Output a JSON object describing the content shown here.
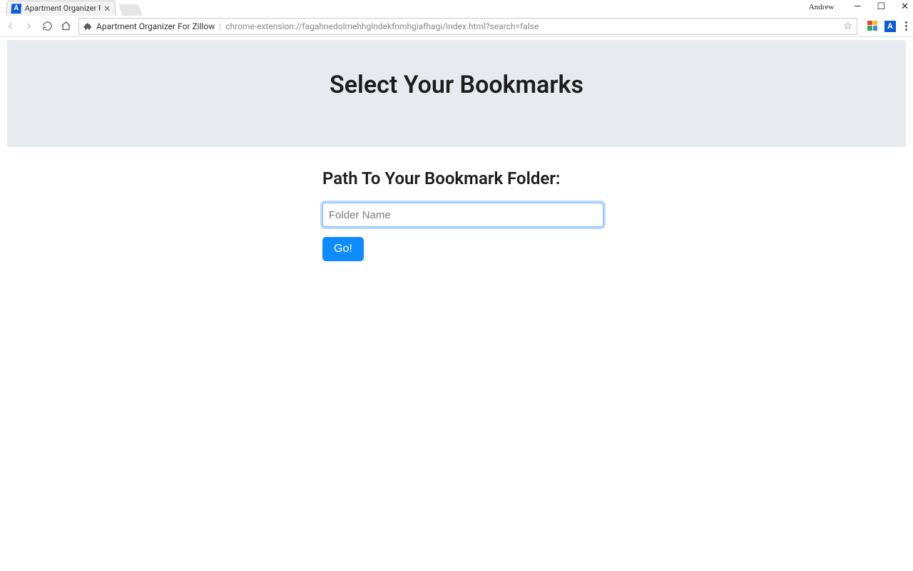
{
  "window": {
    "user_name": "Andrew"
  },
  "tab": {
    "favicon_letter": "A",
    "title": "Apartment Organizer For"
  },
  "omnibox": {
    "ext_title": "Apartment Organizer For Zillow",
    "url": "chrome-extension://fagahnedolmehhglndekfnmhgiafhagi/index.html?search=false"
  },
  "toolbar_ext": {
    "letter_badge": "A"
  },
  "page": {
    "hero_title": "Select Your Bookmarks",
    "form_label": "Path To Your Bookmark Folder:",
    "folder_placeholder": "Folder Name",
    "folder_value": "",
    "go_label": "Go!"
  }
}
